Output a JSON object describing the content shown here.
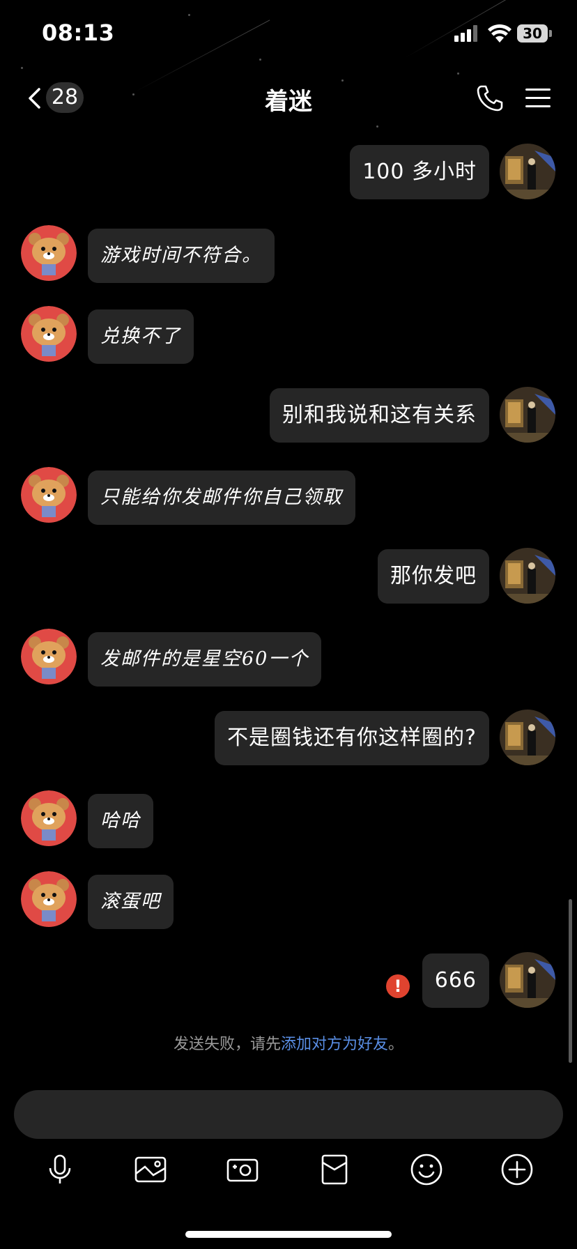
{
  "status_bar": {
    "time": "08:13",
    "battery": "30"
  },
  "nav": {
    "back_count": "28",
    "title": "着迷"
  },
  "messages": [
    {
      "side": "right",
      "text": "100 多小时"
    },
    {
      "side": "left",
      "text": "游戏时间不符合。"
    },
    {
      "side": "left",
      "text": "兑换不了"
    },
    {
      "side": "right",
      "text": "别和我说和这有关系"
    },
    {
      "side": "left",
      "text": "只能给你发邮件你自己领取"
    },
    {
      "side": "right",
      "text": "那你发吧"
    },
    {
      "side": "left",
      "text": "发邮件的是星空60一个"
    },
    {
      "side": "right",
      "text": "不是圈钱还有你这样圈的?"
    },
    {
      "side": "left",
      "text": "哈哈"
    },
    {
      "side": "left",
      "text": "滚蛋吧"
    },
    {
      "side": "right",
      "text": "666",
      "failed": true
    }
  ],
  "system": {
    "prefix": "发送失败，请先",
    "link": "添加对方为好友",
    "suffix": "。"
  },
  "error_mark": "!",
  "toolbar": [
    "microphone-icon",
    "image-icon",
    "camera-icon",
    "red-packet-icon",
    "emoji-icon",
    "plus-icon"
  ],
  "colors": {
    "background": "#000000",
    "bubble": "#262626",
    "link": "#5a8fe6",
    "error": "#e0432f",
    "bear_avatar_bg": "#e04a45"
  }
}
